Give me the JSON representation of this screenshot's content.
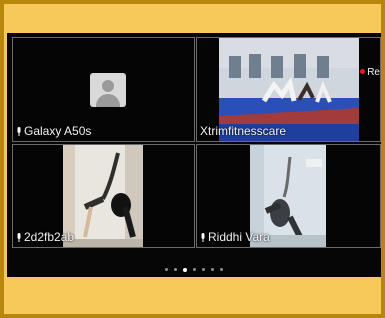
{
  "participants": [
    {
      "name": "Galaxy A50s",
      "video": false
    },
    {
      "name": "Xtrimfitnesscare",
      "video": true
    },
    {
      "name": "2d2fb2ab",
      "video": true
    },
    {
      "name": "Riddhi Vara",
      "video": true
    }
  ],
  "recording_label": "Re",
  "pager": {
    "total_dots": 7,
    "active_index": 2
  },
  "colors": {
    "frame_outer": "#b8860b",
    "frame_inner": "#f6c95a",
    "screen_bg": "#060606",
    "tile_border": "#6b6b6b",
    "recording_dot": "#e02020"
  }
}
